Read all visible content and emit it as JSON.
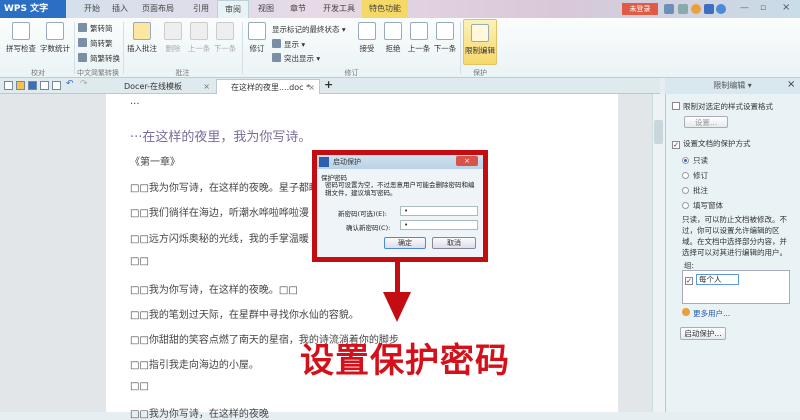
{
  "app": {
    "title": "WPS 文字",
    "login": "未登录"
  },
  "menu_tabs": [
    "开始",
    "插入",
    "页面布局",
    "引用",
    "审阅",
    "视图",
    "章节",
    "开发工具",
    "特色功能"
  ],
  "ribbon": {
    "proofing": {
      "spell": "拼写检查",
      "wordcount": "字数统计",
      "group": "校对"
    },
    "chinese": {
      "t2s": "繁转简",
      "s2t": "简转繁",
      "convert": "简繁转换",
      "group": "中文简繁转换"
    },
    "comments": {
      "insert": "插入批注",
      "delete": "删除",
      "prev": "上一条",
      "next": "下一条",
      "group": "批注"
    },
    "revision": {
      "track": "修订",
      "show_final": "显示标记的最终状态",
      "show": "显示",
      "highlight": "突出显示",
      "accept": "接受",
      "reject": "拒绝",
      "prev": "上一条",
      "next": "下一条",
      "group": "修订"
    },
    "protect": {
      "restrict": "限制编辑",
      "group": "保护"
    }
  },
  "doc_tabs": [
    {
      "label": "Docer-在线模板"
    },
    {
      "label": "在这样的夜里....doc *"
    }
  ],
  "document": {
    "lines": [
      "···",
      "···在这样的夜里，我为你写诗。",
      "《第一章》",
      "□□我为你写诗，在这样的夜晚。星子都睡",
      "□□我们徜徉在海边，听潮水哗啦哗啦漫",
      "□□远方闪烁奥秘的光线，我的手掌温暖",
      "□□",
      "□□我为你写诗，在这样的夜晚。□□",
      "□□我的笔划过天际，在星群中寻找你水仙的容貌。",
      "□□你甜甜的笑容点燃了南天的星宿，我的诗流淌着你的脚步",
      "□□指引我走向海边的小屋。",
      "□□",
      "□□我为你写诗，在这样的夜晚"
    ]
  },
  "dialog": {
    "title": "启动保护",
    "section": "保护密码",
    "hint": "密码可设置为空，不过恶意用户可能会删除密码和编辑文件，建议填写密码。",
    "new_label": "新密码(可选)(E):",
    "new_value": "•",
    "confirm_label": "确认新密码(C):",
    "confirm_value": "•",
    "ok": "确定",
    "cancel": "取消"
  },
  "annotation": "设置保护密码",
  "panel": {
    "title": "限制编辑 ▾",
    "format_limit": "限制对选定的样式设置格式",
    "settings_btn": "设置...",
    "protect_mode": "设置文档的保护方式",
    "options": [
      "只读",
      "修订",
      "批注",
      "填写窗体"
    ],
    "description": "只读，可以防止文档被修改。不过，你可以设置允许编辑的区域。在文档中选择部分内容，并选择可以对其进行编辑的用户。",
    "group_label": "组:",
    "group_item": "每个人",
    "more_users": "更多用户...",
    "start_btn": "启动保护..."
  }
}
